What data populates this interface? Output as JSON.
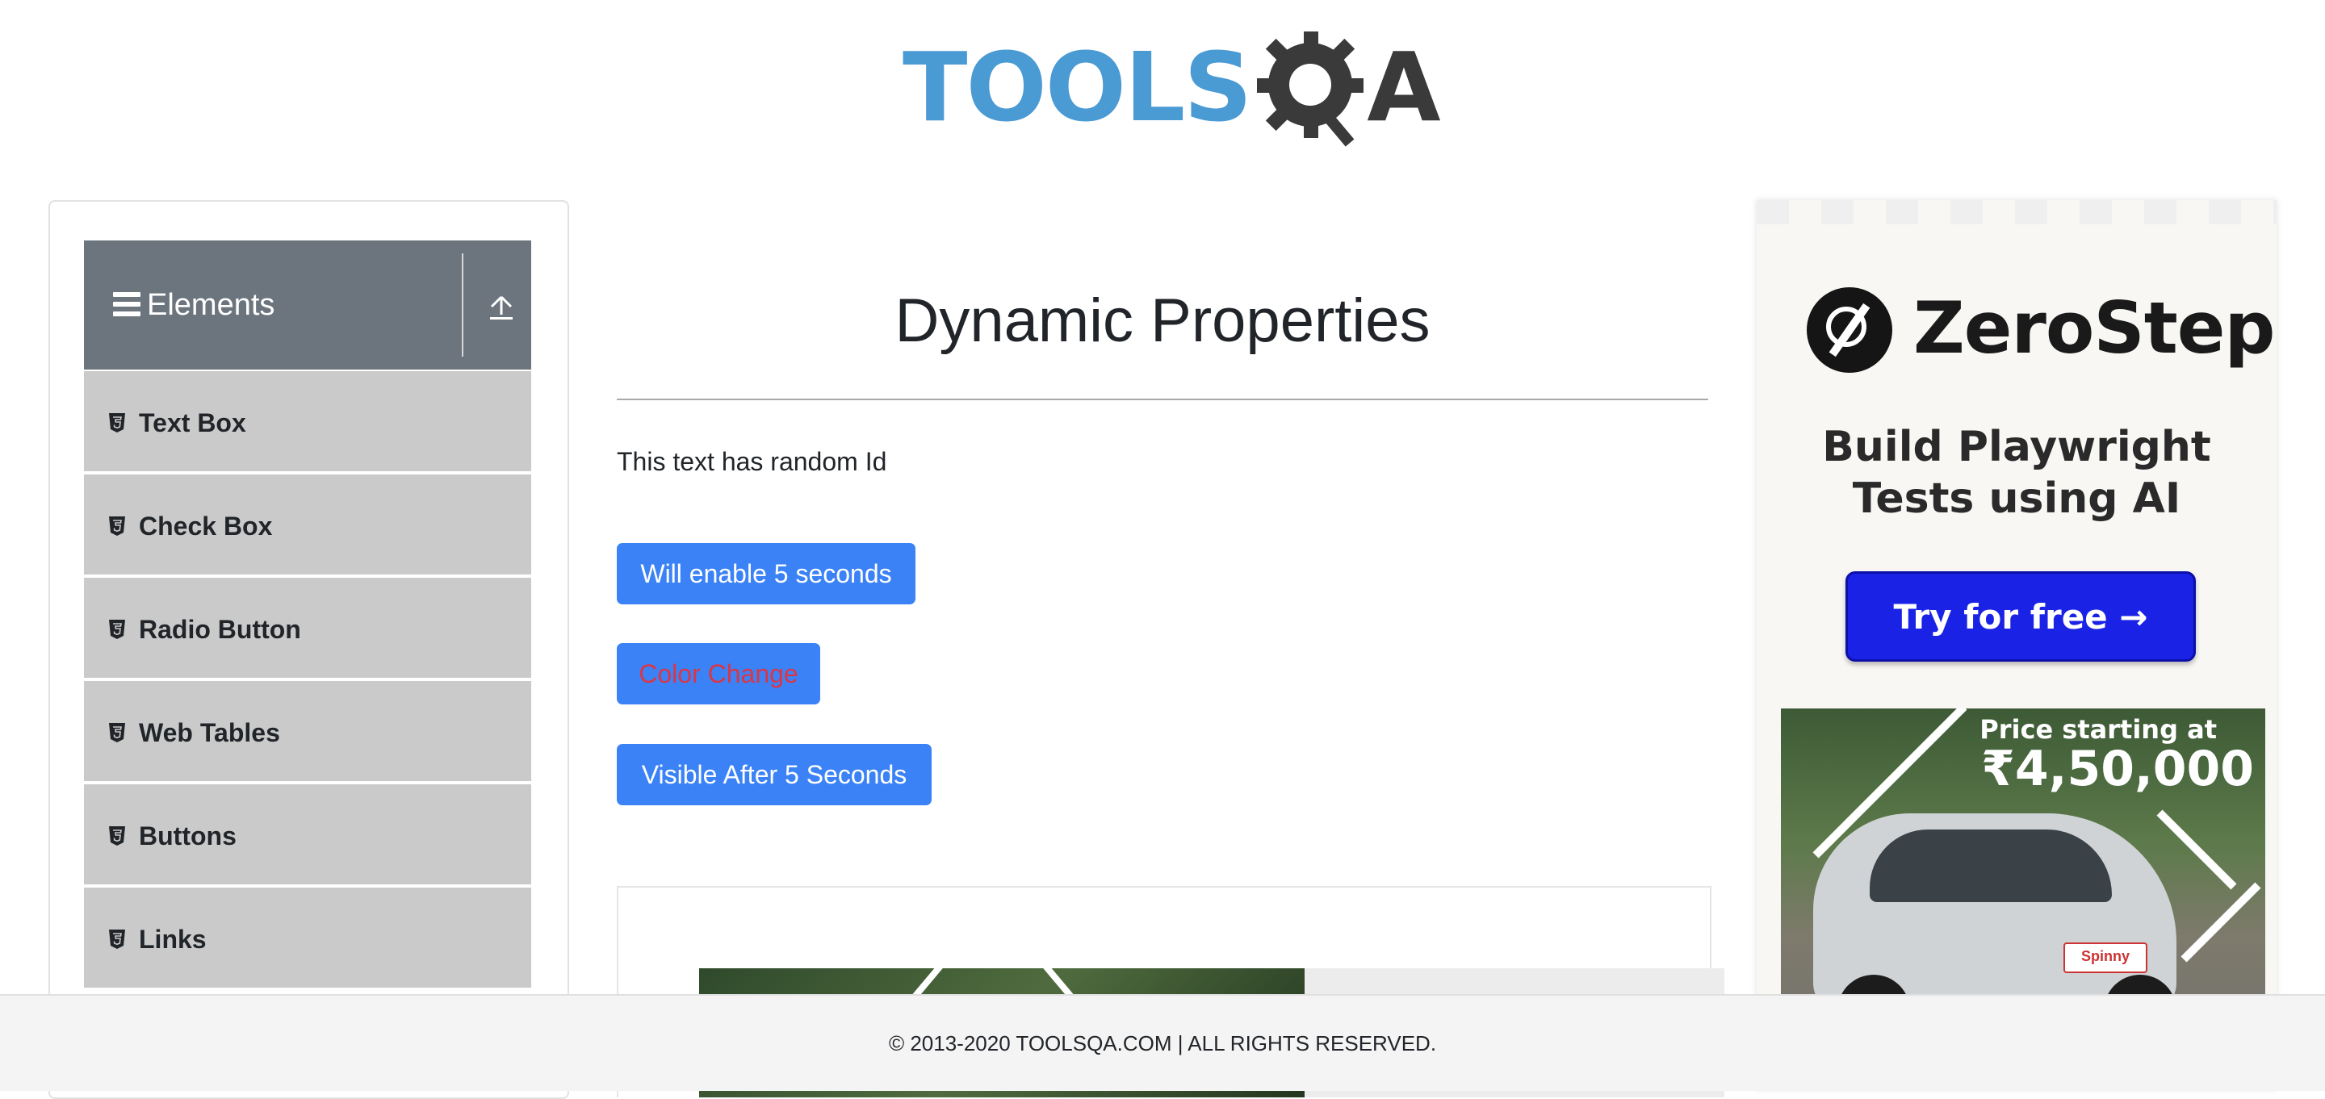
{
  "header": {
    "logo_text": "TOOLS",
    "logo_suffix": "A"
  },
  "sidebar": {
    "group_title": "Elements",
    "items": [
      {
        "label": "Text Box"
      },
      {
        "label": "Check Box"
      },
      {
        "label": "Radio Button"
      },
      {
        "label": "Web Tables"
      },
      {
        "label": "Buttons"
      },
      {
        "label": "Links"
      }
    ]
  },
  "main": {
    "title": "Dynamic Properties",
    "random_id_text": "This text has random Id",
    "buttons": {
      "enable_after": "Will enable 5 seconds",
      "color_change": "Color Change",
      "visible_after": "Visible After 5 Seconds"
    }
  },
  "ad": {
    "brand": "ZeroStep",
    "tagline_line1": "Build Playwright",
    "tagline_line2": "Tests using AI",
    "cta": "Try for free →",
    "car_price_label": "Price starting at",
    "car_price": "₹4,50,000",
    "car_plate": "Spinny"
  },
  "footer": {
    "text": "© 2013-2020 TOOLSQA.COM | ALL RIGHTS RESERVED."
  },
  "colors": {
    "primary_button": "#3b82f6",
    "color_change_text": "#dc3545",
    "sidebar_header": "#6c757d",
    "sidebar_item": "#cacaca",
    "logo_blue": "#4a9ad4",
    "cta_blue": "#1a22e6"
  }
}
